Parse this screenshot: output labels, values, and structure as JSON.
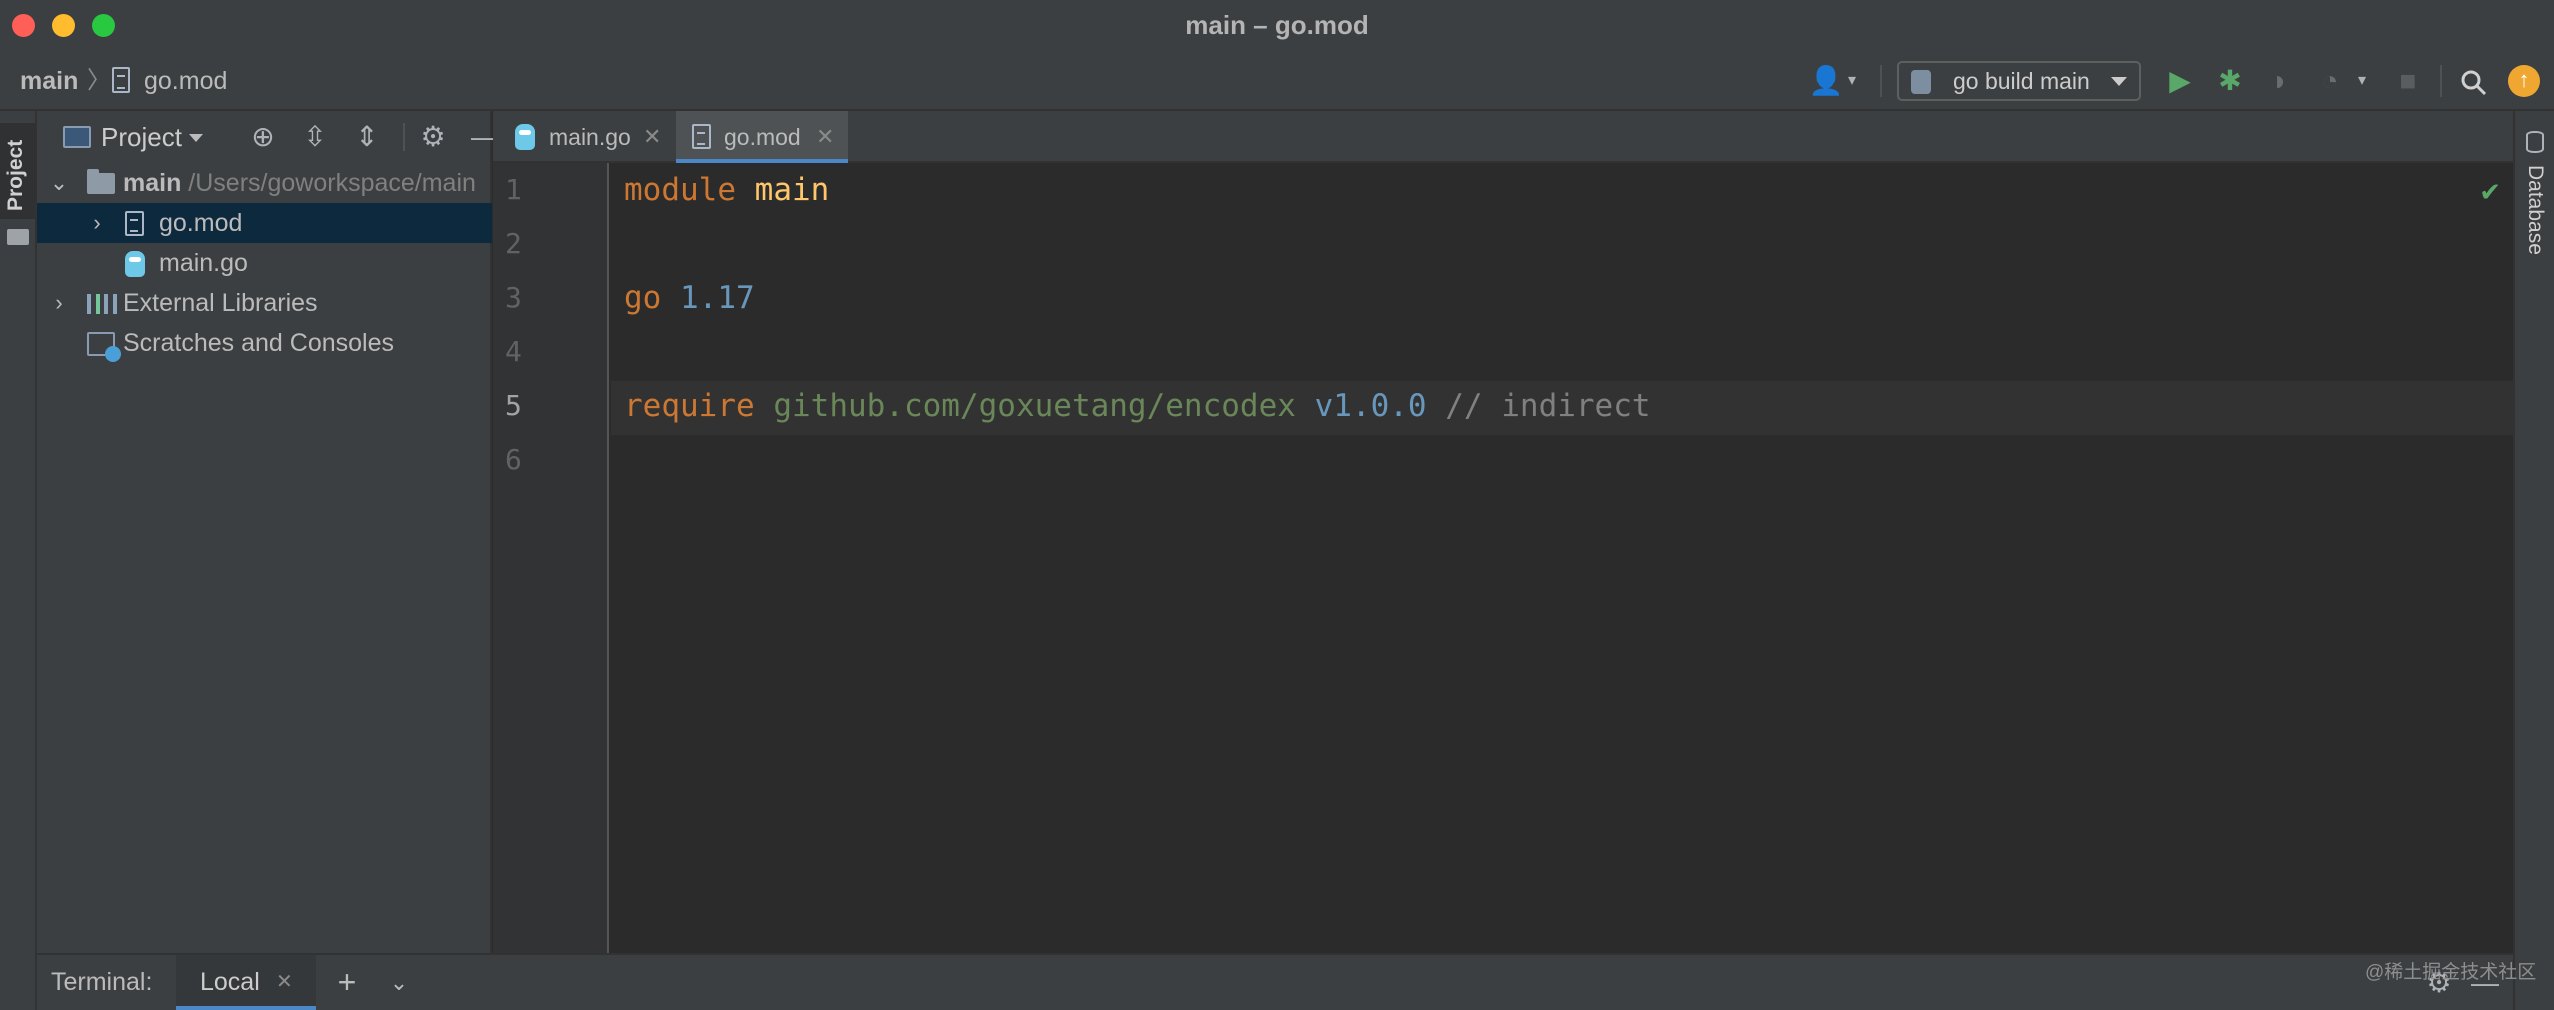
{
  "window": {
    "title": "main – go.mod"
  },
  "breadcrumb": {
    "root": "main",
    "separator": "〉",
    "file": "go.mod"
  },
  "toolbar": {
    "run_config_label": "go build main",
    "icons": [
      "user-icon",
      "run-icon",
      "debug-icon",
      "coverage-icon",
      "profile-icon",
      "stop-icon",
      "search-icon",
      "update-icon"
    ]
  },
  "left_strip": {
    "project_label": "Project"
  },
  "right_strip": {
    "database_label": "Database"
  },
  "project_panel": {
    "title": "Project",
    "tree": [
      {
        "name": "main",
        "path": " /Users/goworkspace/main",
        "expanded": true
      },
      {
        "name": "go.mod",
        "selected": true
      },
      {
        "name": "main.go"
      },
      {
        "name": "External Libraries"
      },
      {
        "name": "Scratches and Consoles"
      }
    ]
  },
  "editor_tabs": [
    {
      "label": "main.go",
      "close": "✕",
      "active": false
    },
    {
      "label": "go.mod",
      "close": "✕",
      "active": true
    }
  ],
  "editor": {
    "line_numbers": [
      "1",
      "2",
      "3",
      "4",
      "5",
      "6"
    ],
    "current_line": "5",
    "lines": {
      "l1": {
        "kw": "module",
        "name": "main"
      },
      "l3": {
        "kw": "go",
        "version": "1.17"
      },
      "l5": {
        "kw": "require",
        "module": "github.com/goxuetang/encodex",
        "version": "v1.0.0",
        "comment": "// indirect"
      }
    }
  },
  "terminal": {
    "label": "Terminal:",
    "tab_label": "Local",
    "tab_close": "✕",
    "add": "+",
    "more": "⌄"
  },
  "watermark": "@稀土掘金技术社区",
  "colors": {
    "keyword": "#cc7832",
    "identifier": "#ffc66d",
    "number": "#6897bb",
    "string": "#6a8759",
    "comment": "#808080",
    "accent": "#4a88c7",
    "run_green": "#59a869",
    "update_orange": "#f0a732"
  }
}
